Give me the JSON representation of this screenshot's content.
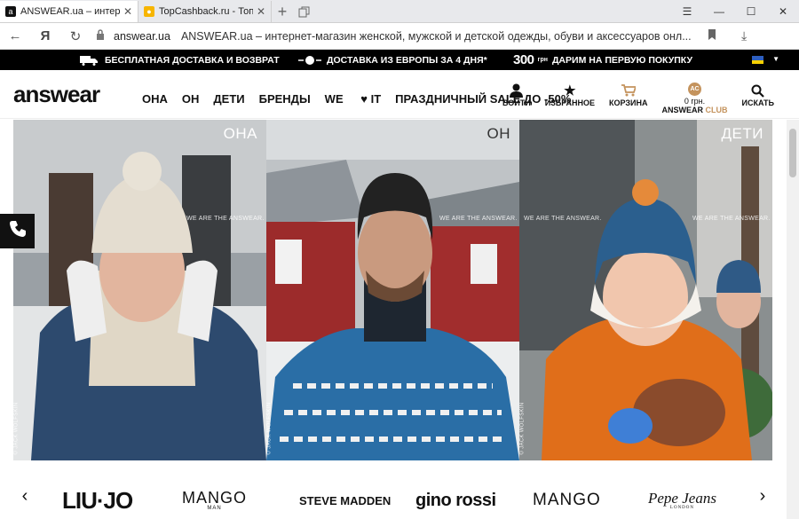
{
  "browser": {
    "tabs": [
      {
        "title": "ANSWEAR.ua – интернет",
        "favicon": "answear-favicon",
        "active": true
      },
      {
        "title": "TopCashback.ru - Топ лучш",
        "favicon": "topcashback-favicon",
        "active": false
      }
    ],
    "address": {
      "domain": "answear.ua",
      "page_title": "ANSWEAR.ua – интернет-магазин женской, мужской и детской одежды, обуви и аксессуаров онл..."
    }
  },
  "promo": {
    "delivery": "БЕСПЛАТНАЯ ДОСТАВКА И ВОЗВРАТ",
    "europe": "ДОСТАВКА ИЗ ЕВРОПЫ ЗА 4 ДНЯ*",
    "gift_amount": "300",
    "gift_unit": "грн",
    "gift_text": "ДАРИМ НА ПЕРВУЮ ПОКУПКУ"
  },
  "header": {
    "logo": "answear",
    "nav": [
      "ОНА",
      "ОН",
      "ДЕТИ",
      "БРЕНДЫ",
      "WE",
      "IT",
      "ПРАЗДНИЧНЫЙ SALE ДО -50%"
    ],
    "tools": {
      "login": "ВОЙТИ",
      "favorites": "ИЗБРАННОЕ",
      "cart": "КОРЗИНА",
      "club_badge": "AC",
      "club_sum": "0 грн.",
      "club_name": "ANSWEAR",
      "club_word": "CLUB",
      "search": "ИСКАТЬ"
    }
  },
  "hero": {
    "panels": [
      {
        "label": "ОНА"
      },
      {
        "label": "ОН"
      },
      {
        "label": "ДЕТИ"
      }
    ],
    "watermark": "WE ARE THE ANSWEAR.",
    "credit": "© JACK WOLFSKIN"
  },
  "brands": {
    "items": [
      "LIU·JO",
      "MANGO",
      "STEVE MADDEN",
      "gino rossi",
      "MANGO",
      "Pepe Jeans"
    ],
    "mango_sub": "MAN",
    "pepe_sub": "LONDON"
  },
  "colors": {
    "promo_bg": "#000000",
    "club_accent": "#c4935d",
    "cart_accent": "#c4935d"
  }
}
